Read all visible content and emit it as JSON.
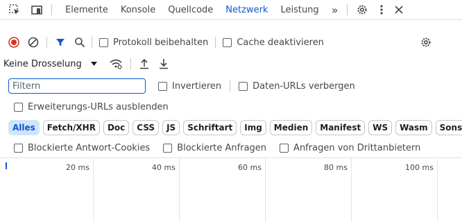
{
  "tabs": {
    "items": [
      "Elemente",
      "Konsole",
      "Quellcode",
      "Netzwerk",
      "Leistung"
    ],
    "active": "Netzwerk",
    "more": "»"
  },
  "toolbar": {
    "preserve_log": "Protokoll beibehalten",
    "disable_cache": "Cache deaktivieren"
  },
  "throttle": {
    "value": "Keine Drosselung"
  },
  "filter": {
    "placeholder": "Filtern",
    "value": "",
    "invert": "Invertieren",
    "hide_data_urls": "Daten-URLs verbergen",
    "hide_extension_urls": "Erweiterungs-URLs ausblenden"
  },
  "types": [
    "Alles",
    "Fetch/XHR",
    "Doc",
    "CSS",
    "JS",
    "Schriftart",
    "Img",
    "Medien",
    "Manifest",
    "WS",
    "Wasm",
    "Sonsti"
  ],
  "types_selected": "Alles",
  "blocking": {
    "blocked_cookies": "Blockierte Antwort-Cookies",
    "blocked_requests": "Blockierte Anfragen",
    "third_party": "Anfragen von Drittanbietern"
  },
  "timeline": {
    "ticks": [
      "20 ms",
      "40 ms",
      "60 ms",
      "80 ms",
      "100 ms"
    ]
  },
  "colors": {
    "accent": "#0b57d0",
    "record": "#d93025",
    "chip_selected_bg": "#d3e3fd"
  }
}
